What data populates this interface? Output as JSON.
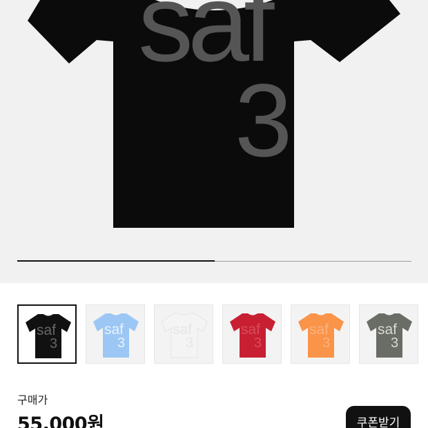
{
  "product": {
    "print_text": "saf",
    "print_number": "3",
    "selected_color": "#0b0b0b",
    "print_color": "#555555"
  },
  "gallery": {
    "progress": 0.5
  },
  "thumbnails": [
    {
      "color": "black",
      "shirt": "#111111",
      "print": "#666666",
      "selected": true
    },
    {
      "color": "light-blue",
      "shirt": "#9cc7f4",
      "print": "#e9f2fc",
      "selected": false
    },
    {
      "color": "white",
      "shirt": "#f4f4f4",
      "print": "#e6e6e6",
      "selected": false
    },
    {
      "color": "red",
      "shirt": "#c81f33",
      "print": "#d84c5c",
      "selected": false
    },
    {
      "color": "orange",
      "shirt": "#f99449",
      "print": "#fbb37e",
      "selected": false
    },
    {
      "color": "gray-green",
      "shirt": "#6a6d66",
      "print": "#d8d8d4",
      "selected": false
    }
  ],
  "purchase": {
    "price_label": "구매가",
    "price": "55,000원",
    "coupon_button": "쿠폰받기"
  }
}
